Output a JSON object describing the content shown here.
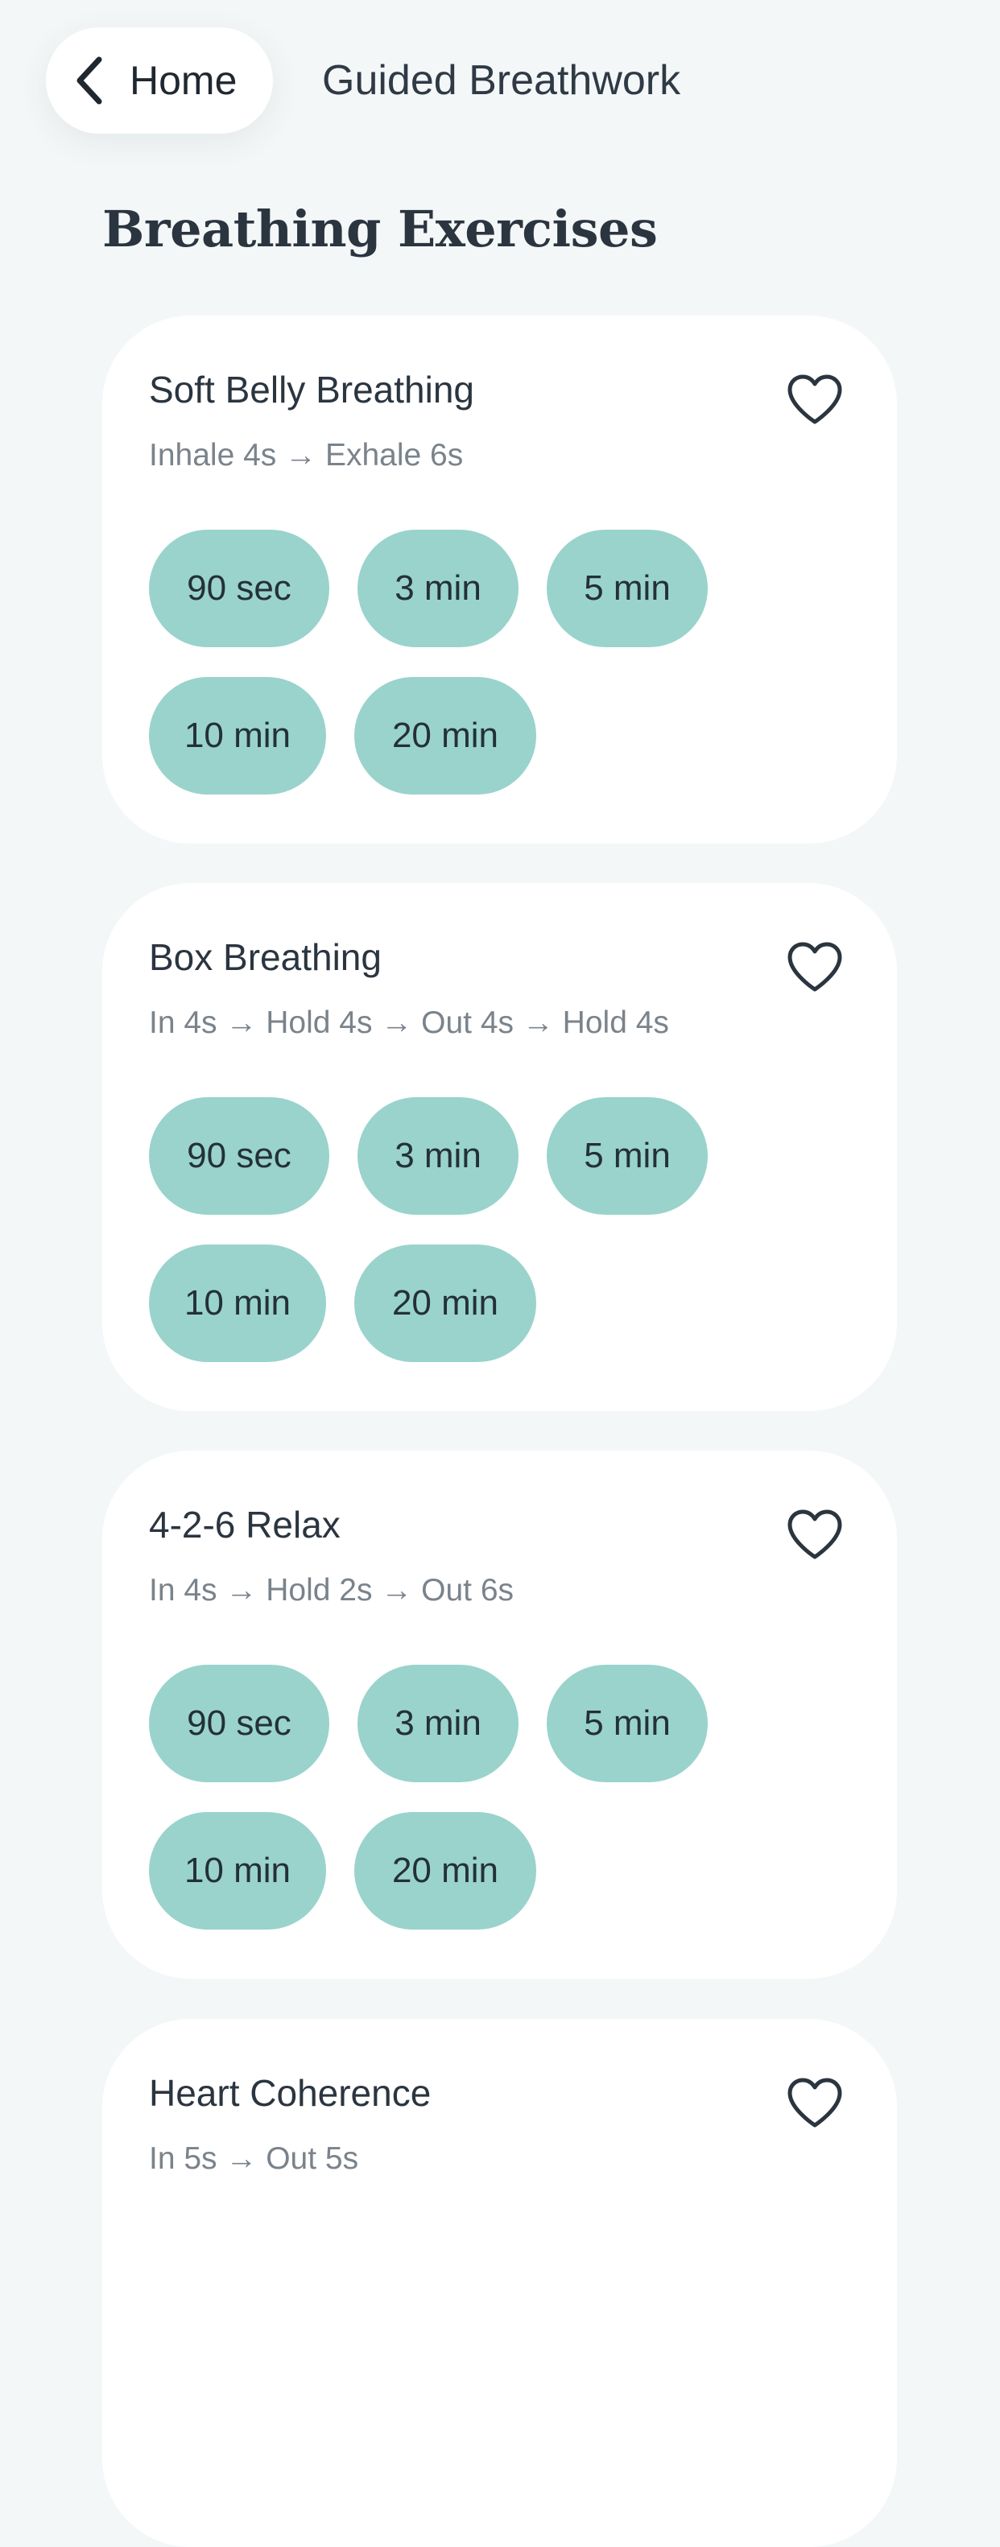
{
  "header": {
    "back_label": "Home",
    "title": "Guided Breathwork"
  },
  "section_title": "Breathing Exercises",
  "exercises": [
    {
      "name": "Soft Belly Breathing",
      "pattern": "Inhale 4s → Exhale 6s",
      "durations": [
        "90 sec",
        "3 min",
        "5 min",
        "10 min",
        "20 min"
      ]
    },
    {
      "name": "Box Breathing",
      "pattern": "In 4s → Hold 4s → Out 4s → Hold 4s",
      "durations": [
        "90 sec",
        "3 min",
        "5 min",
        "10 min",
        "20 min"
      ]
    },
    {
      "name": "4-2-6 Relax",
      "pattern": "In 4s → Hold 2s → Out 6s",
      "durations": [
        "90 sec",
        "3 min",
        "5 min",
        "10 min",
        "20 min"
      ]
    },
    {
      "name": "Heart Coherence",
      "pattern": "In 5s → Out 5s",
      "durations": []
    }
  ],
  "colors": {
    "background": "#f4f7f8",
    "card": "#ffffff",
    "chip": "#99d3cc",
    "text": "#2b3540",
    "subtext": "#7a838b"
  },
  "icons": {
    "back": "chevron-left-icon",
    "favorite": "heart-outline-icon"
  }
}
